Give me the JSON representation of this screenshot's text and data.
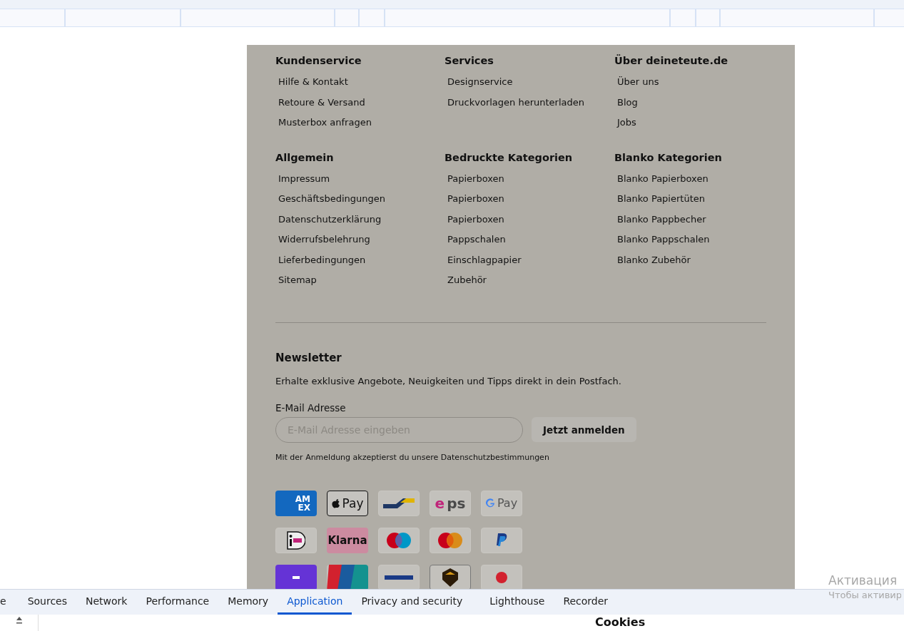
{
  "footer": {
    "columns": [
      {
        "title": "Kundenservice",
        "links": [
          "Hilfe & Kontakt",
          "Retoure & Versand",
          "Musterbox anfragen"
        ]
      },
      {
        "title": "Services",
        "links": [
          "Designservice",
          "Druckvorlagen herunterladen"
        ]
      },
      {
        "title": "Über deineteute.de",
        "links": [
          "Über uns",
          "Blog",
          "Jobs"
        ]
      },
      {
        "title": "Allgemein",
        "links": [
          "Impressum",
          "Geschäftsbedingungen",
          "Datenschutzerklärung",
          "Widerrufsbelehrung",
          "Lieferbedingungen",
          "Sitemap"
        ]
      },
      {
        "title": "Bedruckte Kategorien",
        "links": [
          "Papierboxen",
          "Papierboxen",
          "Papierboxen",
          "Pappschalen",
          "Einschlagpapier",
          "Zubehör"
        ]
      },
      {
        "title": "Blanko Kategorien",
        "links": [
          "Blanko Papierboxen",
          "Blanko Papiertüten",
          "Blanko Pappbecher",
          "Blanko Pappschalen",
          "Blanko Zubehör"
        ]
      }
    ],
    "newsletter": {
      "title": "Newsletter",
      "text": "Erhalte exklusive Angebote, Neuigkeiten und Tipps direkt in dein Postfach.",
      "label": "E-Mail Adresse",
      "placeholder": "E-Mail Adresse eingeben",
      "button": "Jetzt anmelden",
      "note": "Mit der Anmeldung akzeptierst du unsere Datenschutzbestimmungen"
    },
    "payments": [
      {
        "kind": "amex",
        "label": "AM EX"
      },
      {
        "kind": "applepay",
        "label": "Pay"
      },
      {
        "kind": "bancontact"
      },
      {
        "kind": "eps",
        "label": "eps"
      },
      {
        "kind": "googlepay",
        "label": "Pay"
      },
      {
        "kind": "ideal"
      },
      {
        "kind": "klarna",
        "label": "Klarna"
      },
      {
        "kind": "maestro"
      },
      {
        "kind": "mastercard"
      },
      {
        "kind": "paypal"
      },
      {
        "kind": "purple"
      },
      {
        "kind": "unionpay"
      },
      {
        "kind": "plain"
      },
      {
        "kind": "shield"
      },
      {
        "kind": "redmark"
      }
    ]
  },
  "devtools": {
    "tabs": [
      {
        "label": "e",
        "selected": false
      },
      {
        "label": "Sources",
        "selected": false
      },
      {
        "label": "Network",
        "selected": false
      },
      {
        "label": "Performance",
        "selected": false
      },
      {
        "label": "Memory",
        "selected": false
      },
      {
        "label": "Application",
        "selected": true
      },
      {
        "label": "Privacy and security",
        "selected": false
      },
      {
        "label": "Lighthouse",
        "selected": false
      },
      {
        "label": "Recorder",
        "selected": false
      }
    ],
    "panel_heading": "Cookies"
  },
  "activation": {
    "title": "Активация",
    "text": "Чтобы активир"
  }
}
